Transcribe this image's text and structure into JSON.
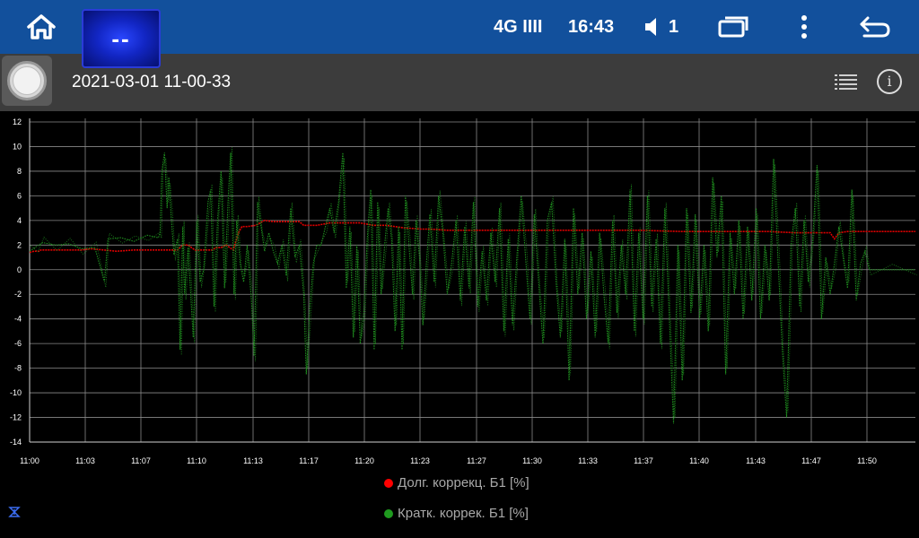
{
  "statusbar": {
    "app_thumb_label": "--",
    "network": "4G IIII",
    "time": "16:43",
    "volume": "1"
  },
  "titlebar": {
    "session": "2021-03-01 11-00-33"
  },
  "chart_data": {
    "type": "line",
    "x_ticks": [
      "11:00",
      "11:03",
      "11:07",
      "11:10",
      "11:13",
      "11:17",
      "11:20",
      "11:23",
      "11:27",
      "11:30",
      "11:33",
      "11:37",
      "11:40",
      "11:43",
      "11:47",
      "11:50"
    ],
    "y_ticks": [
      12,
      10,
      8,
      6,
      4,
      2,
      0,
      -2,
      -4,
      -6,
      -8,
      -10,
      -12,
      -14
    ],
    "ylim": [
      -14,
      12
    ],
    "grid": true,
    "legend_position": "bottom-center",
    "series": [
      {
        "name": "Долг. коррекц. Б1 [%]",
        "color": "#e00000",
        "points": [
          [
            0,
            1.4
          ],
          [
            5,
            1.5
          ],
          [
            11,
            1.5
          ],
          [
            13,
            1.6
          ],
          [
            22,
            1.6
          ],
          [
            30,
            1.6
          ],
          [
            60,
            1.6
          ],
          [
            70,
            1.7
          ],
          [
            85,
            1.6
          ],
          [
            100,
            1.5
          ],
          [
            120,
            1.6
          ],
          [
            150,
            1.6
          ],
          [
            158,
            1.6
          ],
          [
            163,
            1.6
          ],
          [
            170,
            1.6
          ],
          [
            176,
            2.0
          ],
          [
            182,
            2.0
          ],
          [
            190,
            1.6
          ],
          [
            200,
            1.6
          ],
          [
            210,
            1.6
          ],
          [
            214,
            1.8
          ],
          [
            220,
            1.8
          ],
          [
            226,
            2.0
          ],
          [
            234,
            1.6
          ],
          [
            240,
            3.0
          ],
          [
            244,
            3.5
          ],
          [
            250,
            3.5
          ],
          [
            260,
            3.6
          ],
          [
            270,
            4.0
          ],
          [
            280,
            3.9
          ],
          [
            300,
            3.9
          ],
          [
            310,
            3.9
          ],
          [
            315,
            3.6
          ],
          [
            330,
            3.6
          ],
          [
            345,
            3.8
          ],
          [
            360,
            3.8
          ],
          [
            380,
            3.8
          ],
          [
            395,
            3.6
          ],
          [
            410,
            3.6
          ],
          [
            430,
            3.4
          ],
          [
            450,
            3.3
          ],
          [
            460,
            3.3
          ],
          [
            480,
            3.2
          ],
          [
            520,
            3.2
          ],
          [
            560,
            3.2
          ],
          [
            600,
            3.2
          ],
          [
            650,
            3.2
          ],
          [
            700,
            3.2
          ],
          [
            750,
            3.1
          ],
          [
            800,
            3.1
          ],
          [
            850,
            3.1
          ],
          [
            880,
            3.0
          ],
          [
            900,
            3.0
          ],
          [
            920,
            3.0
          ],
          [
            925,
            2.5
          ],
          [
            930,
            3.0
          ],
          [
            940,
            3.1
          ],
          [
            960,
            3.1
          ],
          [
            990,
            3.1
          ],
          [
            1018,
            3.1
          ]
        ]
      },
      {
        "name": "Кратк. коррек. Б1 [%]",
        "color": "#1f8f1f",
        "points": [
          [
            0,
            1.5
          ],
          [
            8,
            1.9
          ],
          [
            15,
            2.2
          ],
          [
            30,
            2.0
          ],
          [
            45,
            2.1
          ],
          [
            60,
            1.7
          ],
          [
            75,
            1.8
          ],
          [
            86,
            -1.0
          ],
          [
            90,
            2.5
          ],
          [
            105,
            2.6
          ],
          [
            120,
            2.3
          ],
          [
            135,
            2.8
          ],
          [
            148,
            2.6
          ],
          [
            150,
            3.0
          ],
          [
            152,
            8.0
          ],
          [
            155,
            9.5
          ],
          [
            158,
            5.0
          ],
          [
            160,
            7.5
          ],
          [
            163,
            4.0
          ],
          [
            166,
            1.2
          ],
          [
            170,
            2.5
          ],
          [
            173,
            -6.5
          ],
          [
            176,
            3.5
          ],
          [
            178,
            -2.0
          ],
          [
            182,
            1.8
          ],
          [
            188,
            -5.5
          ],
          [
            192,
            4.0
          ],
          [
            196,
            -1.0
          ],
          [
            200,
            0.0
          ],
          [
            205,
            5.5
          ],
          [
            208,
            6.5
          ],
          [
            212,
            -3.0
          ],
          [
            216,
            4.0
          ],
          [
            220,
            8.0
          ],
          [
            224,
            -1.5
          ],
          [
            228,
            5.5
          ],
          [
            231,
            9.5
          ],
          [
            235,
            -2.0
          ],
          [
            238,
            4.0
          ],
          [
            242,
            0.5
          ],
          [
            246,
            -1.0
          ],
          [
            250,
            2.0
          ],
          [
            255,
            -2.5
          ],
          [
            258,
            -7.0
          ],
          [
            262,
            5.5
          ],
          [
            266,
            3.5
          ],
          [
            270,
            1.5
          ],
          [
            275,
            3.0
          ],
          [
            280,
            1.5
          ],
          [
            285,
            0.5
          ],
          [
            290,
            2.0
          ],
          [
            295,
            -0.5
          ],
          [
            300,
            5.0
          ],
          [
            305,
            1.0
          ],
          [
            310,
            2.0
          ],
          [
            315,
            -2.0
          ],
          [
            318,
            -8.5
          ],
          [
            322,
            -3.0
          ],
          [
            326,
            0.5
          ],
          [
            330,
            2.0
          ],
          [
            335,
            2.0
          ],
          [
            340,
            3.5
          ],
          [
            345,
            5.0
          ],
          [
            350,
            3.0
          ],
          [
            355,
            5.5
          ],
          [
            360,
            9.5
          ],
          [
            364,
            -1.5
          ],
          [
            368,
            3.5
          ],
          [
            372,
            -5.5
          ],
          [
            376,
            2.0
          ],
          [
            380,
            -6.0
          ],
          [
            384,
            -3.5
          ],
          [
            388,
            2.5
          ],
          [
            392,
            6.5
          ],
          [
            396,
            -6.5
          ],
          [
            400,
            5.5
          ],
          [
            404,
            -2.0
          ],
          [
            408,
            2.0
          ],
          [
            412,
            5.0
          ],
          [
            416,
            2.5
          ],
          [
            420,
            -5.0
          ],
          [
            424,
            3.5
          ],
          [
            428,
            -6.5
          ],
          [
            432,
            6.0
          ],
          [
            436,
            2.0
          ],
          [
            440,
            -2.0
          ],
          [
            444,
            4.0
          ],
          [
            448,
            1.0
          ],
          [
            452,
            -4.5
          ],
          [
            456,
            0.5
          ],
          [
            460,
            4.5
          ],
          [
            465,
            -1.0
          ],
          [
            470,
            6.0
          ],
          [
            475,
            3.0
          ],
          [
            480,
            -2.0
          ],
          [
            485,
            0.5
          ],
          [
            490,
            4.0
          ],
          [
            495,
            -2.5
          ],
          [
            500,
            3.5
          ],
          [
            505,
            -1.5
          ],
          [
            510,
            5.5
          ],
          [
            515,
            -3.0
          ],
          [
            520,
            1.5
          ],
          [
            525,
            -2.5
          ],
          [
            530,
            3.0
          ],
          [
            535,
            -1.0
          ],
          [
            540,
            5.0
          ],
          [
            545,
            -5.0
          ],
          [
            550,
            2.5
          ],
          [
            555,
            -4.5
          ],
          [
            560,
            1.0
          ],
          [
            565,
            6.0
          ],
          [
            570,
            1.0
          ],
          [
            575,
            -4.0
          ],
          [
            580,
            4.5
          ],
          [
            585,
            -1.0
          ],
          [
            590,
            -6.0
          ],
          [
            595,
            4.0
          ],
          [
            600,
            5.5
          ],
          [
            605,
            -1.0
          ],
          [
            610,
            -5.5
          ],
          [
            615,
            2.5
          ],
          [
            620,
            -9.0
          ],
          [
            625,
            5.0
          ],
          [
            630,
            -2.0
          ],
          [
            635,
            3.0
          ],
          [
            640,
            -4.0
          ],
          [
            645,
            1.5
          ],
          [
            650,
            -5.5
          ],
          [
            655,
            3.0
          ],
          [
            660,
            -2.0
          ],
          [
            665,
            -6.0
          ],
          [
            670,
            4.0
          ],
          [
            675,
            -3.5
          ],
          [
            680,
            2.0
          ],
          [
            685,
            -2.0
          ],
          [
            690,
            6.5
          ],
          [
            695,
            -5.0
          ],
          [
            700,
            3.0
          ],
          [
            705,
            -4.0
          ],
          [
            710,
            6.0
          ],
          [
            715,
            -3.0
          ],
          [
            720,
            2.5
          ],
          [
            725,
            -6.0
          ],
          [
            730,
            5.0
          ],
          [
            735,
            -3.5
          ],
          [
            740,
            -12.5
          ],
          [
            745,
            2.0
          ],
          [
            750,
            -9.0
          ],
          [
            755,
            5.0
          ],
          [
            760,
            -3.5
          ],
          [
            765,
            4.5
          ],
          [
            770,
            -4.0
          ],
          [
            775,
            2.0
          ],
          [
            780,
            -5.0
          ],
          [
            785,
            7.5
          ],
          [
            790,
            1.0
          ],
          [
            795,
            6.0
          ],
          [
            800,
            -8.5
          ],
          [
            805,
            3.0
          ],
          [
            810,
            -2.0
          ],
          [
            815,
            4.0
          ],
          [
            820,
            -4.0
          ],
          [
            825,
            3.5
          ],
          [
            830,
            -2.5
          ],
          [
            835,
            5.0
          ],
          [
            840,
            -4.0
          ],
          [
            845,
            2.0
          ],
          [
            850,
            -2.5
          ],
          [
            855,
            9.0
          ],
          [
            860,
            1.0
          ],
          [
            865,
            -6.5
          ],
          [
            870,
            -12.0
          ],
          [
            875,
            2.0
          ],
          [
            880,
            5.0
          ],
          [
            885,
            -3.0
          ],
          [
            890,
            4.0
          ],
          [
            895,
            -1.0
          ],
          [
            900,
            2.5
          ],
          [
            905,
            8.5
          ],
          [
            910,
            -4.0
          ],
          [
            915,
            1.0
          ],
          [
            920,
            -2.0
          ],
          [
            925,
            0.5
          ],
          [
            930,
            3.5
          ],
          [
            935,
            1.0
          ],
          [
            940,
            -1.5
          ],
          [
            945,
            6.5
          ],
          [
            950,
            -2.5
          ],
          [
            955,
            0.5
          ],
          [
            960,
            1.5
          ],
          [
            965,
            0.0
          ],
          [
            990,
            0.0
          ],
          [
            1018,
            0.0
          ]
        ]
      }
    ]
  },
  "legend": {
    "long": "Долг. коррекц. Б1 [%]",
    "short": "Кратк. коррек. Б1 [%]"
  }
}
